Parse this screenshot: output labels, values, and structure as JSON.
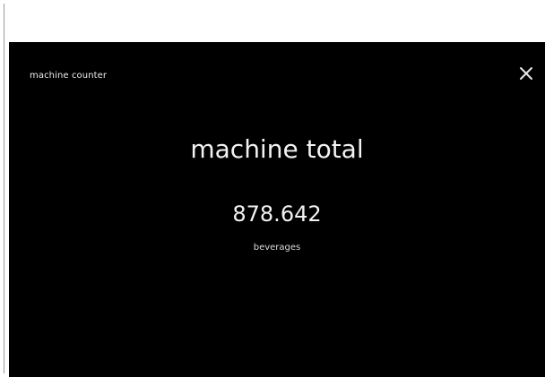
{
  "screen": {
    "title": "machine counter",
    "close_icon": "close-icon"
  },
  "counter": {
    "heading": "machine total",
    "value": "878.642",
    "unit": "beverages"
  },
  "colors": {
    "background": "#000000",
    "text": "#f2f2f2",
    "page": "#ffffff"
  }
}
